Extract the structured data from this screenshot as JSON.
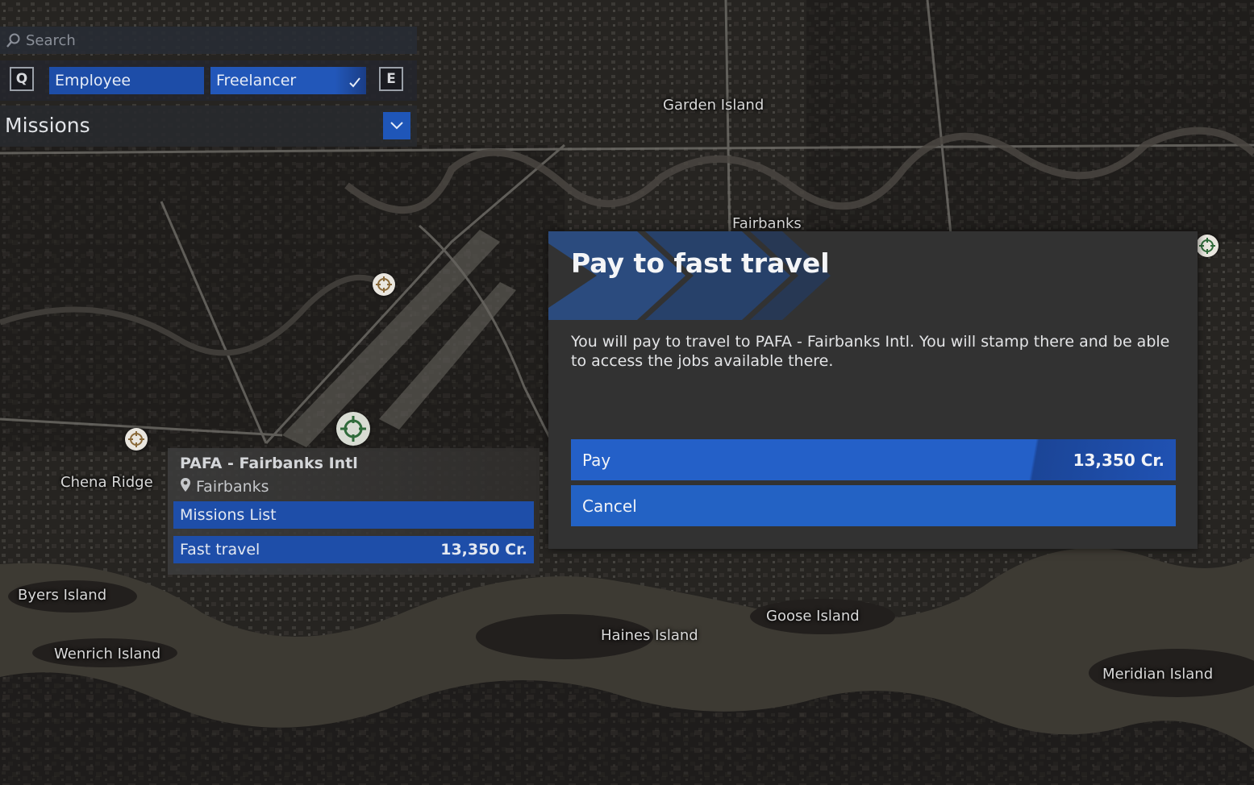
{
  "search": {
    "placeholder": "Search"
  },
  "mode_tabs": {
    "prev_key": "Q",
    "next_key": "E",
    "items": [
      {
        "label": "Employee",
        "selected": false
      },
      {
        "label": "Freelancer",
        "selected": true
      }
    ]
  },
  "missions_panel": {
    "title": "Missions"
  },
  "map": {
    "labels": [
      {
        "text": "Garden Island"
      },
      {
        "text": "Fairbanks"
      },
      {
        "text": "Chena Ridge"
      },
      {
        "text": "Byers Island"
      },
      {
        "text": "Wenrich Island"
      },
      {
        "text": "Haines Island"
      },
      {
        "text": "Goose Island"
      },
      {
        "text": "Meridian Island"
      }
    ]
  },
  "location_card": {
    "title": "PAFA - Fairbanks Intl",
    "subtitle": "Fairbanks",
    "missions_list_label": "Missions List",
    "fast_travel_label": "Fast travel",
    "fast_travel_price": "13,350 Cr."
  },
  "dialog": {
    "title": "Pay to fast travel",
    "body": "You will pay to travel to PAFA - Fairbanks Intl. You will stamp there and be able to access the jobs available there.",
    "pay_label": "Pay",
    "pay_price": "13,350 Cr.",
    "cancel_label": "Cancel"
  },
  "colors": {
    "accent_blue": "#2362c4",
    "dialog_bg": "#323232",
    "map_land": "#3a3632",
    "map_river": "#4a463e"
  },
  "icons": [
    "search-icon",
    "checkmark-icon",
    "chevron-down-icon",
    "location-pin-icon",
    "map-target-icon"
  ]
}
